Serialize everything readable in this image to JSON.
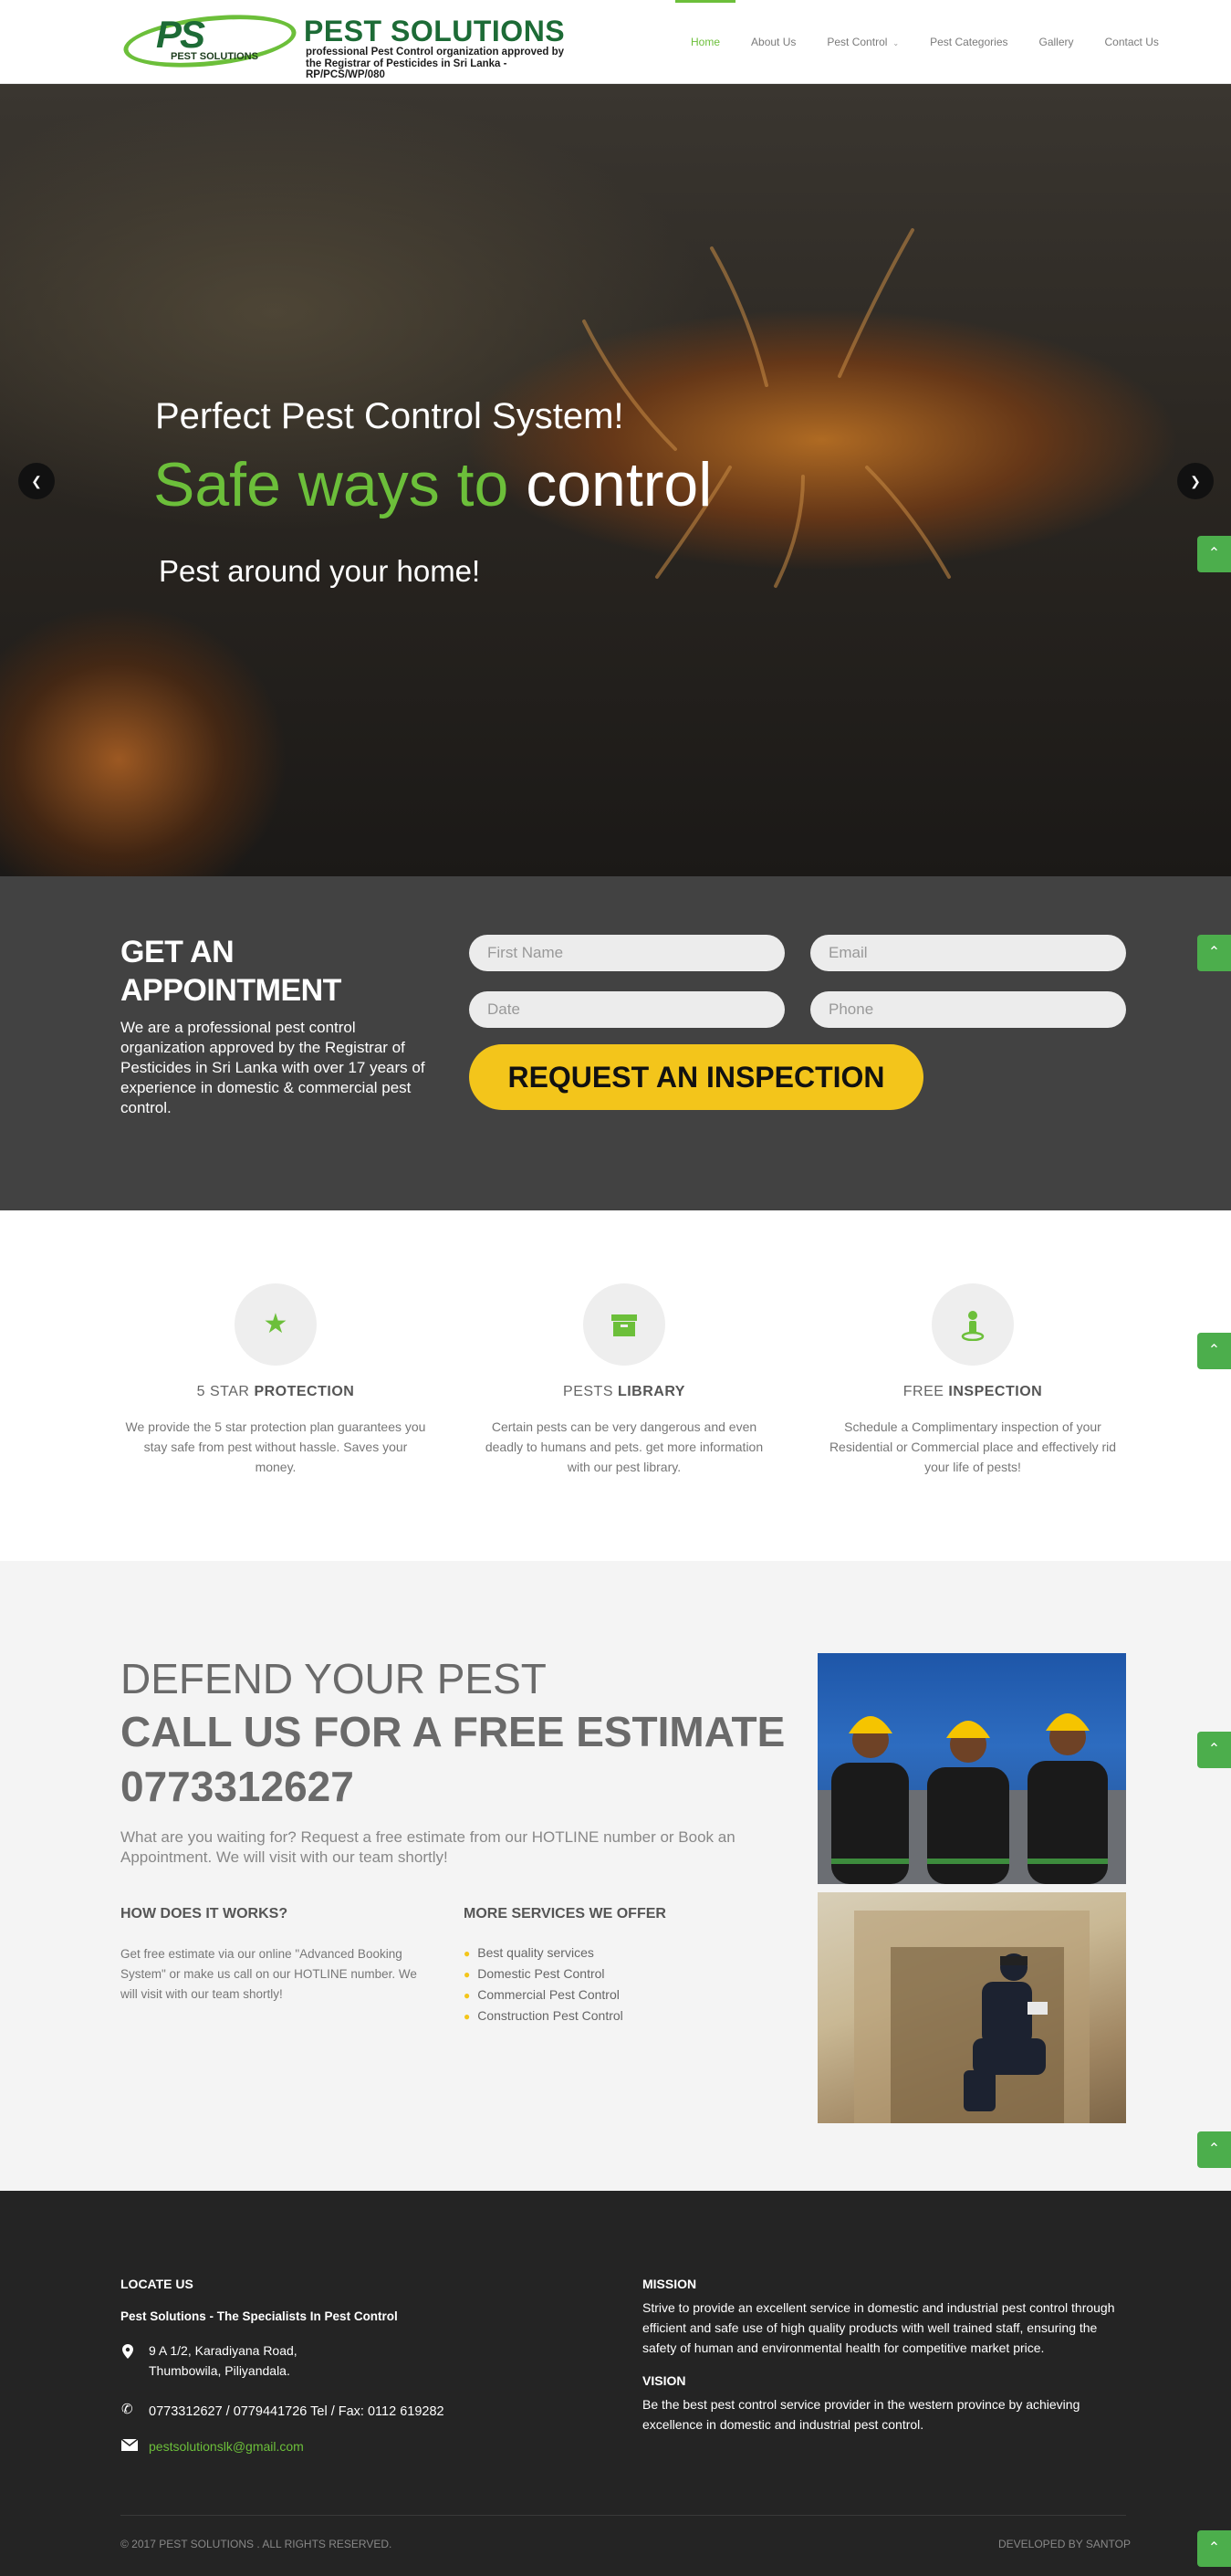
{
  "header": {
    "logo": {
      "ps_mark": "PS",
      "ps_sub": "PEST SOLUTIONS",
      "title": "PEST SOLUTIONS",
      "tagline1": "professional Pest Control organization approved by",
      "tagline2": "the Registrar of Pesticides in Sri Lanka - RP/PCS/WP/080"
    },
    "nav": [
      "Home",
      "About Us",
      "Pest Control",
      "Pest Categories",
      "Gallery",
      "Contact Us"
    ],
    "active": "Home"
  },
  "hero": {
    "line1": "Perfect Pest Control System!",
    "line2_green": "Safe ways to",
    "line2_white": "control",
    "line3": "Pest around your home!"
  },
  "appointment": {
    "title": "GET AN APPOINTMENT",
    "text": "We are a professional pest control organization approved by the Registrar of Pesticides in Sri Lanka with over 17 years of experience in domestic & commercial pest control.",
    "fields": {
      "first_name": "First Name",
      "email": "Email",
      "date": "Date",
      "phone": "Phone"
    },
    "button": "REQUEST AN INSPECTION"
  },
  "features": [
    {
      "title_light": "5 STAR",
      "title_bold": "PROTECTION",
      "text": "We provide the 5 star protection plan guarantees you stay safe from pest without hassle. Saves your money.",
      "icon": "star-icon"
    },
    {
      "title_light": "PESTS",
      "title_bold": "LIBRARY",
      "text": "Certain pests can be very dangerous and even deadly to humans and pets. get more information with our pest library.",
      "icon": "archive-icon"
    },
    {
      "title_light": "FREE",
      "title_bold": "INSPECTION",
      "text": "Schedule a Complimentary inspection of your Residential or Commercial place and effectively rid your life of pests!",
      "icon": "inspector-icon"
    }
  ],
  "estimate": {
    "heading1": "DEFEND YOUR PEST",
    "heading2": "CALL US FOR A FREE ESTIMATE",
    "phone": "0773312627",
    "text": "What are you waiting for? Request a free estimate from our HOTLINE number or Book an Appointment. We will visit with our team shortly!",
    "how_title": "HOW DOES IT WORKS?",
    "how_text": "Get free estimate via our online \"Advanced Booking System\" or make us call on our HOTLINE number. We will visit with our team shortly!",
    "services_title": "MORE SERVICES WE OFFER",
    "services": [
      "Best quality services",
      "Domestic Pest Control",
      "Commercial Pest Control",
      "Construction Pest Control"
    ]
  },
  "footer": {
    "locate_title": "LOCATE US",
    "company": "Pest Solutions - The Specialists In Pest Control",
    "address1": "9 A 1/2, Karadiyana Road,",
    "address2": "Thumbowila, Piliyandala.",
    "phones": "0773312627 / 0779441726 Tel / Fax: 0112 619282",
    "email": "pestsolutionslk@gmail.com",
    "mission_title": "MISSION",
    "mission_text": "Strive to provide an excellent service in domestic and industrial pest control through efficient and safe use of high quality products with well trained staff, ensuring the safety of human and environmental health for competitive market price.",
    "vision_title": "VISION",
    "vision_text": "Be the best pest control service provider in the western province by achieving excellence in domestic and industrial pest control.",
    "copyright": "© 2017 PEST SOLUTIONS . ALL RIGHTS RESERVED.",
    "developer": "DEVELOPED BY SANTOP"
  },
  "colors": {
    "brand_green": "#6cbf3a",
    "accent_yellow": "#f3c51b",
    "appointment_bg": "#424242",
    "footer_bg": "#242424"
  }
}
